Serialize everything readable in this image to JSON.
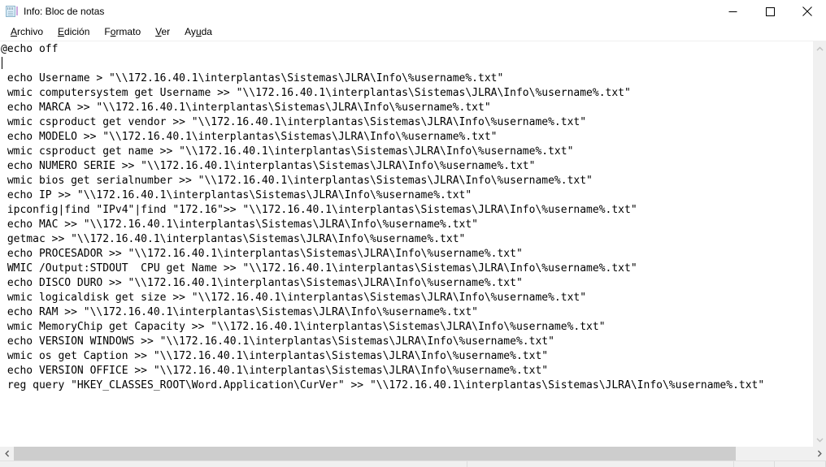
{
  "window": {
    "title": "Info: Bloc de notas",
    "icon": "notepad-icon",
    "controls": {
      "minimize": "–",
      "maximize": "□",
      "close": "✕"
    }
  },
  "menubar": {
    "items": [
      {
        "label": "Archivo",
        "accel_index": 0
      },
      {
        "label": "Edición",
        "accel_index": 0
      },
      {
        "label": "Formato",
        "accel_index": 1
      },
      {
        "label": "Ver",
        "accel_index": 0
      },
      {
        "label": "Ayuda",
        "accel_index": 2
      }
    ]
  },
  "editor": {
    "lines": [
      "@echo off",
      "",
      " echo Username > \"\\\\172.16.40.1\\interplantas\\Sistemas\\JLRA\\Info\\%username%.txt\"",
      " wmic computersystem get Username >> \"\\\\172.16.40.1\\interplantas\\Sistemas\\JLRA\\Info\\%username%.txt\"",
      " echo MARCA >> \"\\\\172.16.40.1\\interplantas\\Sistemas\\JLRA\\Info\\%username%.txt\"",
      " wmic csproduct get vendor >> \"\\\\172.16.40.1\\interplantas\\Sistemas\\JLRA\\Info\\%username%.txt\"",
      " echo MODELO >> \"\\\\172.16.40.1\\interplantas\\Sistemas\\JLRA\\Info\\%username%.txt\"",
      " wmic csproduct get name >> \"\\\\172.16.40.1\\interplantas\\Sistemas\\JLRA\\Info\\%username%.txt\"",
      " echo NUMERO SERIE >> \"\\\\172.16.40.1\\interplantas\\Sistemas\\JLRA\\Info\\%username%.txt\"",
      " wmic bios get serialnumber >> \"\\\\172.16.40.1\\interplantas\\Sistemas\\JLRA\\Info\\%username%.txt\"",
      " echo IP >> \"\\\\172.16.40.1\\interplantas\\Sistemas\\JLRA\\Info\\%username%.txt\"",
      " ipconfig|find \"IPv4\"|find \"172.16\">> \"\\\\172.16.40.1\\interplantas\\Sistemas\\JLRA\\Info\\%username%.txt\"",
      " echo MAC >> \"\\\\172.16.40.1\\interplantas\\Sistemas\\JLRA\\Info\\%username%.txt\"",
      " getmac >> \"\\\\172.16.40.1\\interplantas\\Sistemas\\JLRA\\Info\\%username%.txt\"",
      " echo PROCESADOR >> \"\\\\172.16.40.1\\interplantas\\Sistemas\\JLRA\\Info\\%username%.txt\"",
      " WMIC /Output:STDOUT  CPU get Name >> \"\\\\172.16.40.1\\interplantas\\Sistemas\\JLRA\\Info\\%username%.txt\"",
      " echo DISCO DURO >> \"\\\\172.16.40.1\\interplantas\\Sistemas\\JLRA\\Info\\%username%.txt\"",
      " wmic logicaldisk get size >> \"\\\\172.16.40.1\\interplantas\\Sistemas\\JLRA\\Info\\%username%.txt\"",
      " echo RAM >> \"\\\\172.16.40.1\\interplantas\\Sistemas\\JLRA\\Info\\%username%.txt\"",
      " wmic MemoryChip get Capacity >> \"\\\\172.16.40.1\\interplantas\\Sistemas\\JLRA\\Info\\%username%.txt\"",
      " echo VERSION WINDOWS >> \"\\\\172.16.40.1\\interplantas\\Sistemas\\JLRA\\Info\\%username%.txt\"",
      " wmic os get Caption >> \"\\\\172.16.40.1\\interplantas\\Sistemas\\JLRA\\Info\\%username%.txt\"",
      " echo VERSION OFFICE >> \"\\\\172.16.40.1\\interplantas\\Sistemas\\JLRA\\Info\\%username%.txt\"",
      " reg query \"HKEY_CLASSES_ROOT\\Word.Application\\CurVer\" >> \"\\\\172.16.40.1\\interplantas\\Sistemas\\JLRA\\Info\\%username%.txt\""
    ],
    "caret_line_index": 1
  },
  "scrollbars": {
    "vertical": {
      "up_arrow": "⌃",
      "down_arrow": "⌄",
      "thumb_visible": false
    },
    "horizontal": {
      "left_arrow": "‹",
      "right_arrow": "›",
      "thumb_visible": true
    }
  },
  "colors": {
    "window_bg": "#ffffff",
    "text": "#000000",
    "scroll_track": "#f0f0f0",
    "scroll_thumb": "#cdcdcd",
    "status_bg": "#f0f0f0"
  }
}
